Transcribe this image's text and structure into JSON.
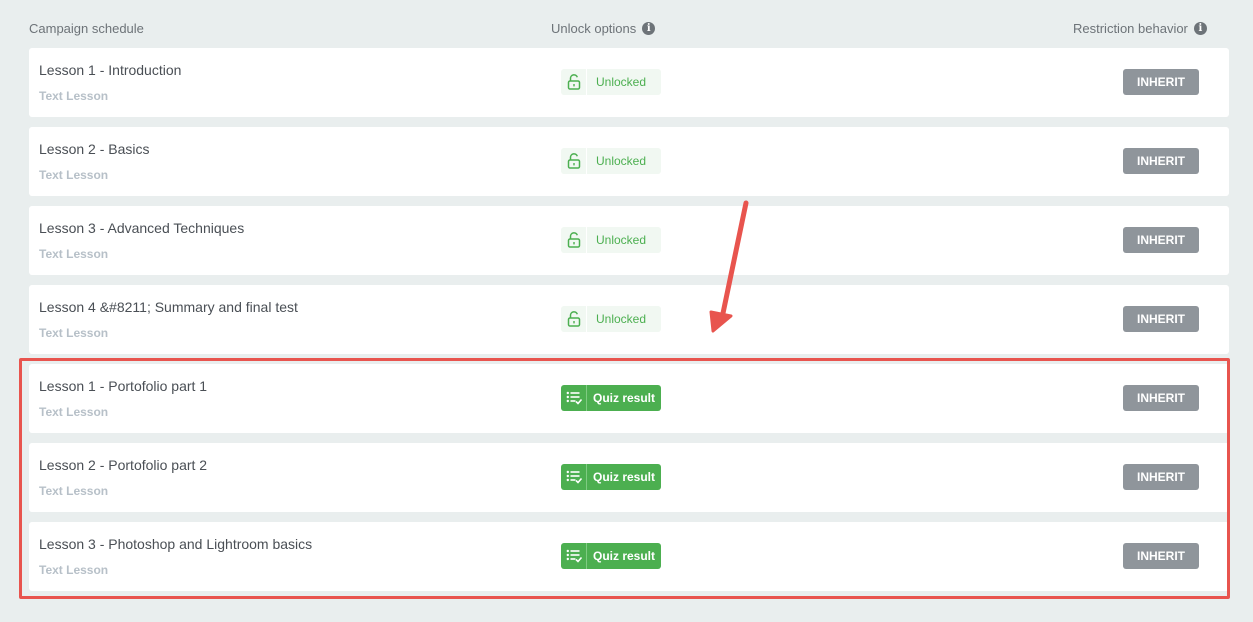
{
  "header": {
    "schedule_label": "Campaign schedule",
    "unlock_label": "Unlock options",
    "restriction_label": "Restriction behavior",
    "info_glyph": "i"
  },
  "lessons": [
    {
      "title": "Lesson 1 - Introduction",
      "type": "Text Lesson",
      "unlock_kind": "unlocked",
      "unlock_label": "Unlocked",
      "restriction": "INHERIT"
    },
    {
      "title": "Lesson 2 - Basics",
      "type": "Text Lesson",
      "unlock_kind": "unlocked",
      "unlock_label": "Unlocked",
      "restriction": "INHERIT"
    },
    {
      "title": "Lesson 3 - Advanced Techniques",
      "type": "Text Lesson",
      "unlock_kind": "unlocked",
      "unlock_label": "Unlocked",
      "restriction": "INHERIT"
    },
    {
      "title": "Lesson 4 &#8211; Summary and final test",
      "type": "Text Lesson",
      "unlock_kind": "unlocked",
      "unlock_label": "Unlocked",
      "restriction": "INHERIT"
    },
    {
      "title": "Lesson 1 - Portofolio part 1",
      "type": "Text Lesson",
      "unlock_kind": "quiz",
      "unlock_label": "Quiz result",
      "restriction": "INHERIT"
    },
    {
      "title": "Lesson 2 - Portofolio part 2",
      "type": "Text Lesson",
      "unlock_kind": "quiz",
      "unlock_label": "Quiz result",
      "restriction": "INHERIT"
    },
    {
      "title": "Lesson 3 - Photoshop and Lightroom basics",
      "type": "Text Lesson",
      "unlock_kind": "quiz",
      "unlock_label": "Quiz result",
      "restriction": "INHERIT"
    }
  ],
  "icons": {
    "unlocked": "unlock-icon",
    "quiz": "quiz-list-icon",
    "info": "info-icon"
  },
  "colors": {
    "background": "#e9eeee",
    "unlocked_green": "#4caf50",
    "quiz_green": "#4caf50",
    "inherit_gray": "#8f959b",
    "annotation_red": "#e8544e"
  }
}
